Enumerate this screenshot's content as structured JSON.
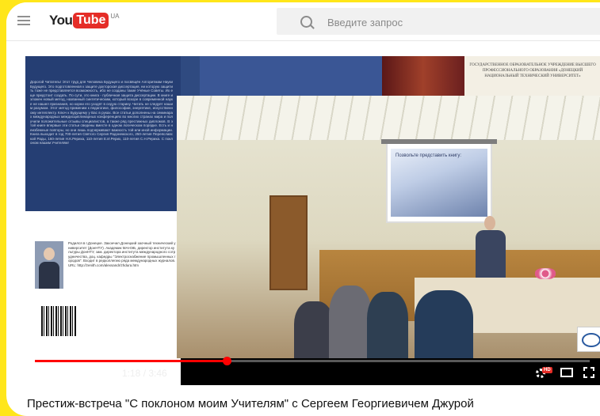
{
  "header": {
    "logo_you": "You",
    "logo_tube": "Tube",
    "logo_region": "UA",
    "search_placeholder": "Введите запрос"
  },
  "video": {
    "book_back_text": "Дорогой Читатель! Этот труд для Человека Будущего и посвящён Алгоритмам Науки Будущего. Это подготовленная к защите докторская диссертация, ни которую защитить тоже не представляется возможность, ибо не созданы такие Учёные Советы. Их еще предстоит создать. По сути, это книга - публичная защита диссертации. В книге изложен новый метод, названный синтетическим, который вскоре в современной науке не нашел признания, но корни его уходят в седую старину. Читать не следует нашим разумом. Этот метод применим к педагогике, философии, энергетике, искусственному интеллекту. Ключ к Будущему у Вас в руках. Все статьи дополнены на семинарах международных междисциплинарных конференциях во многих странах мира и получили положительные отзывы специалистов, а также ряд престижных дипломов. В этой книге впервые эти статьи сведены вместе в одном логическом порядке. Есть и неизбежные повторы, но они лишь подчеркивают важность той или иной информации. Книга выходит в год 700-летия Святого Сергия Радонежского, 250-летия Переяславской Рады, 160-летия Н.К.Рериха, 110-летия Е.И.Рерих, 110-летия С.Н.Рериха. С поклоном нашим Учителям!",
    "author_bio": "Родился в г.Донецке. Закончил Донецкий заочный технический университет (ДонНТУ). Академик МАНЭБ, директор института культуры ДонНТУ, зам. директора института международного сотрудничества, доц. кафедры \"Электроснабжение промышленных городов\". Входит в редколлегию ряда международных журналов. URL: http://zenith.com/alexsandr/zhdura.htm",
    "university_header": "ГОСУДАРСТВЕННОЕ ОБРАЗОВАТЕЛЬНОЕ УЧРЕЖДЕНИЕ ВЫСШЕГО ПРОФЕССИОНАЛЬНОГО ОБРАЗОВАНИЯ «ДОНЕЦКИЙ НАЦИОНАЛЬНЫЙ ТЕХНИЧЕСКИЙ УНИВЕРСИТЕТ»",
    "slide_title": "Позвольте представить книгу:",
    "time_display": "1:18 / 3:46",
    "progress_fraction": 0.345,
    "hd_badge": "HD",
    "accent_color": "#ff0000",
    "title": "Престиж-встреча \"С поклоном моим Учителям\" с Сергеем Георгиевичем Джурой"
  },
  "icons": {
    "menu": "hamburger-icon",
    "search": "search-icon",
    "play": "play-icon",
    "next": "next-icon",
    "mute": "mute-icon",
    "settings": "gear-icon",
    "theater": "theater-mode-icon",
    "fullscreen": "fullscreen-icon"
  }
}
